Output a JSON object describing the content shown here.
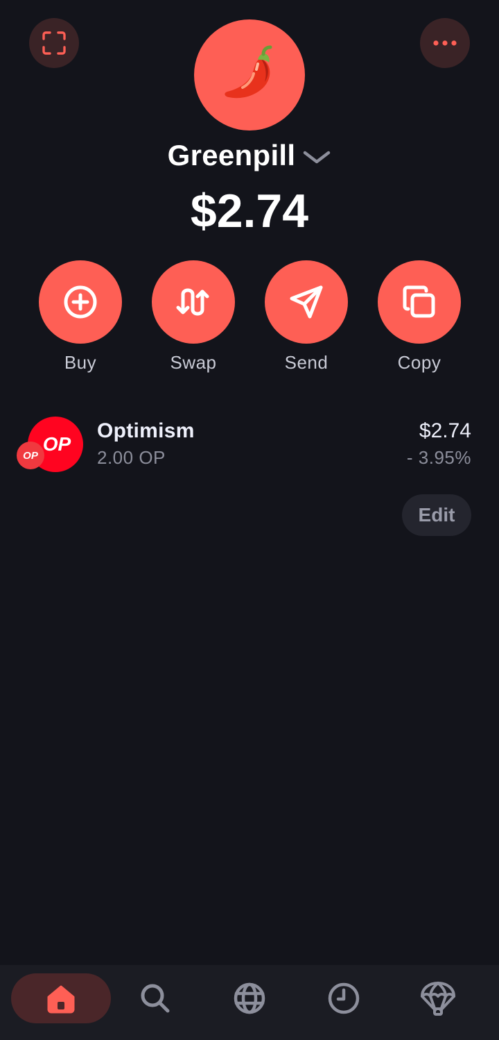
{
  "header": {
    "scan_icon": "scan-qr-icon",
    "more_icon": "more-horizontal-icon",
    "avatar_emoji": "🌶️",
    "account_name": "Greenpill",
    "balance": "$2.74"
  },
  "actions": [
    {
      "label": "Buy",
      "icon": "plus-circle-icon"
    },
    {
      "label": "Swap",
      "icon": "swap-arrows-icon"
    },
    {
      "label": "Send",
      "icon": "send-icon"
    },
    {
      "label": "Copy",
      "icon": "copy-icon"
    }
  ],
  "tokens": [
    {
      "logo_text": "OP",
      "chain_badge": "OP",
      "name": "Optimism",
      "amount": "2.00 OP",
      "value": "$2.74",
      "change": "- 3.95%"
    }
  ],
  "edit_label": "Edit",
  "nav": [
    {
      "icon": "home-icon",
      "active": true
    },
    {
      "icon": "search-icon",
      "active": false
    },
    {
      "icon": "globe-icon",
      "active": false
    },
    {
      "icon": "clock-icon",
      "active": false
    },
    {
      "icon": "parachute-icon",
      "active": false
    }
  ],
  "colors": {
    "background": "#13141b",
    "accent": "#fe5f55",
    "op_red": "#ff0420",
    "nav_background": "#1b1c23"
  }
}
